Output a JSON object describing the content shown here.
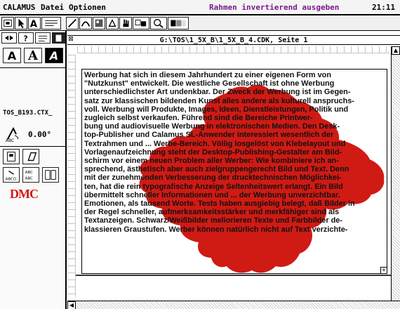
{
  "menubar": {
    "app": "CALAMUS",
    "menu_file": "Datei",
    "menu_options": "Optionen",
    "status": "Rahmen invertierend ausgeben",
    "clock": "21:11"
  },
  "window": {
    "title": "G:\\TOS\\1_5X_B\\1_5X_B_4.CDK, Seite 1",
    "closer_glyph": "⊠"
  },
  "leftpanel": {
    "frame_name": "TOS_B193.CTX_",
    "angle": "0.00°",
    "logo": "DMC",
    "text_letter": "A"
  },
  "colors": {
    "red_shape": "#d01a14",
    "status_text": "#7a1a8a",
    "logo_red": "#d01a14"
  },
  "icons": [
    "window-closer-icon",
    "arrow-pointer-icon",
    "text-tool-icon",
    "rotate-icon",
    "red-dmc-logo"
  ],
  "body": {
    "lines": [
      "Werbung hat sich in diesem Jahrhundert zu einer eigenen Form von",
      "\"Nutzkunst\" entwickelt. Die westliche Gesellschaft ist ohne Werbung",
      "unterschiedlichster Art undenkbar. Der Zweck der Werbung ist im Gegen-",
      "satz zur klassischen bildenden Kunst alles andere als kulturell anspruchs-",
      "voll. Werbung will Produkte, Images, Ideen, Dienstleistungen, Politik und",
      "zugleich selbst verkaufen. Führend sind die Bereiche Printwer-",
      "bung und audiovisuelle Werbung in elektronischen Medien. Den Desk-",
      "top-Publisher und Calamus SL-Anwender interessiert wesentlich der",
      "Textrahmen und ... Werbe-Bereich. Völlig losgelöst von Klebelayout und",
      "Vorlagenaufzeichnung steht der Desktop-Publishing-Gestalter am Bild-",
      "schirm vor einem neuen Problem aller Werber: Wie kombiniere ich an-",
      "sprechend, ästhetisch aber auch zielgruppengerecht Bild und Text. Denn",
      "mit der zunehmenden Verbesserung der drucktechnischen Möglichkei-",
      "ten, hat die rein typografische Anzeige Seltenheitswert erlangt. Ein Bild",
      "übermittelt schneller Informationen und ... der Werbung unverzichtbar.",
      "Emotionen, als tausend Worte. Tests haben ausgiebig belegt, daß Bilder in",
      "der Regel schneller, aufmerksamkeitsstärker und merkfähiger sind als",
      "Textanzeigen. Schwarz/Weißbilder meliorieren Texte und Farbbilder de-",
      "klassieren Graustufen. Werber können natürlich nicht auf Text verzichte-"
    ]
  }
}
